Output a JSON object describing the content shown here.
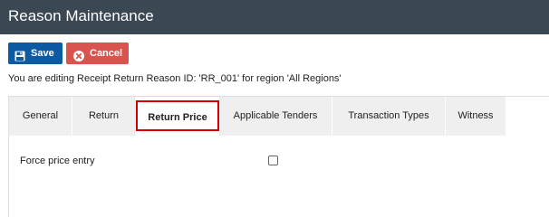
{
  "header": {
    "title": "Reason Maintenance"
  },
  "toolbar": {
    "save_label": "Save",
    "cancel_label": "Cancel"
  },
  "info_text": "You are editing Receipt Return Reason ID: 'RR_001' for region 'All Regions'",
  "tabs": [
    {
      "label": "General"
    },
    {
      "label": "Return"
    },
    {
      "label": "Return Price"
    },
    {
      "label": "Applicable Tenders"
    },
    {
      "label": "Transaction Types"
    },
    {
      "label": "Witness"
    }
  ],
  "active_tab": "Return Price",
  "fields": {
    "force_price_entry": {
      "label": "Force price entry",
      "checked": false
    }
  },
  "colors": {
    "header_bg": "#3b4753",
    "save_button": "#0b5aa2",
    "cancel_button": "#d9534f",
    "active_tab_border": "#d40000"
  },
  "icons": {
    "save": "floppy-disk-icon",
    "cancel": "x-circle-icon"
  }
}
